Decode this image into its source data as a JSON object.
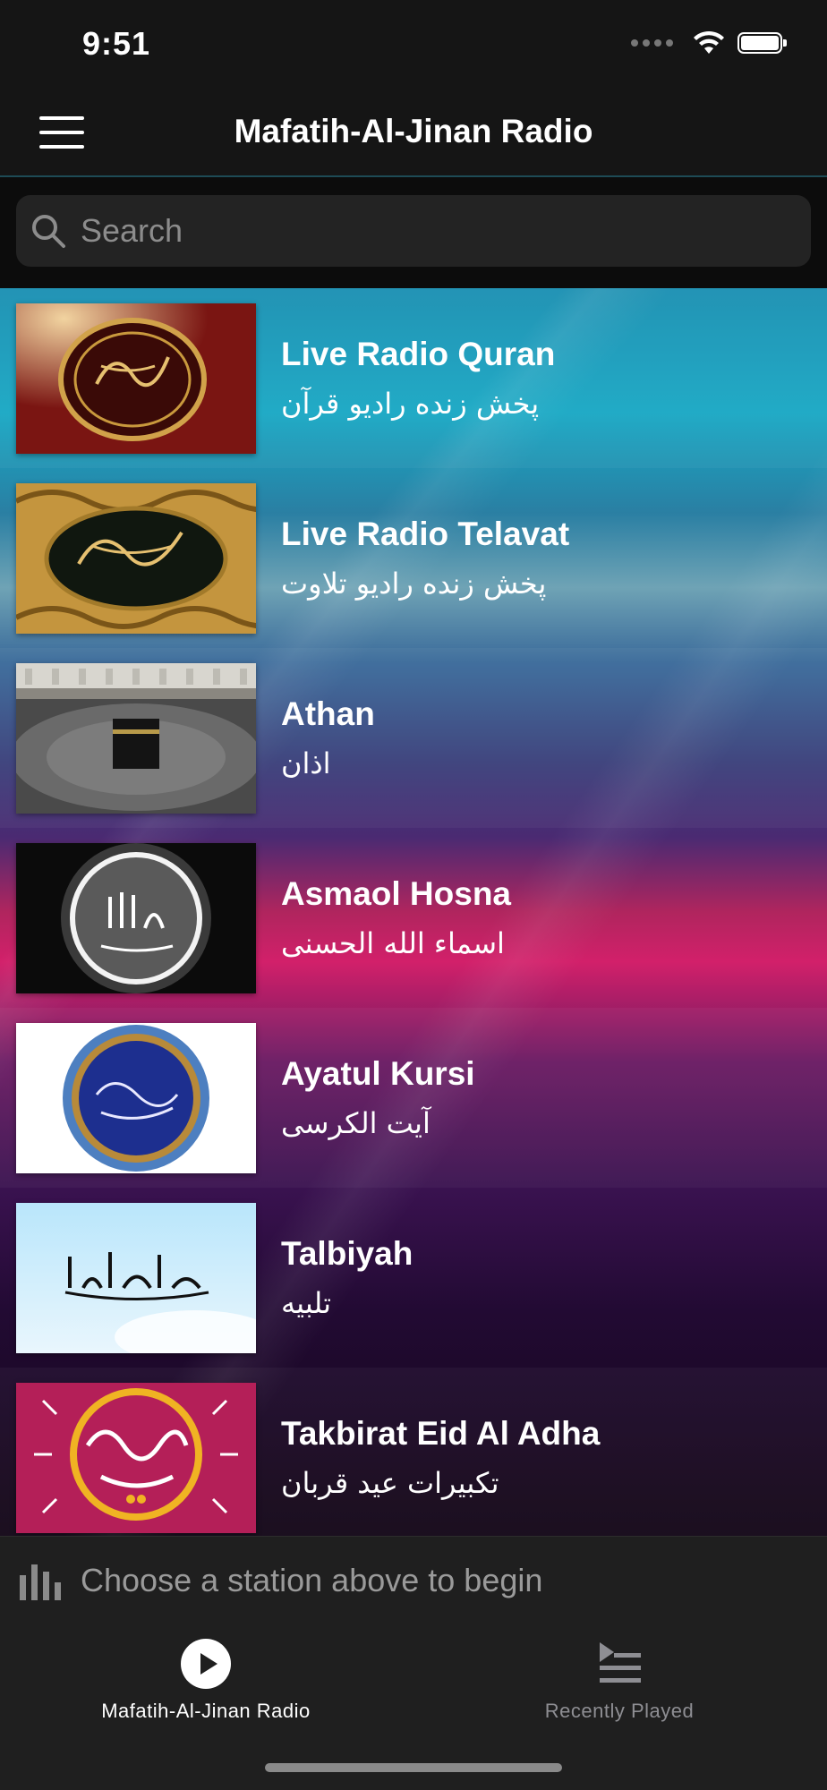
{
  "status_bar": {
    "time": "9:51"
  },
  "nav": {
    "title": "Mafatih-Al-Jinan Radio",
    "menu_icon": "hamburger-icon"
  },
  "search": {
    "placeholder": "Search",
    "value": ""
  },
  "stations": [
    {
      "title": "Live Radio Quran",
      "subtitle": "پخش زنده رادیو قرآن",
      "thumbnail": "quran-cover-red"
    },
    {
      "title": "Live Radio Telavat",
      "subtitle": "پخش زنده رادیو تلاوت",
      "thumbnail": "quran-cover-gold"
    },
    {
      "title": "Athan",
      "subtitle": "اذان",
      "thumbnail": "kaaba-photo"
    },
    {
      "title": "Asmaol Hosna",
      "subtitle": "اسماء الله الحسنی",
      "thumbnail": "allah-calligraphy-circle"
    },
    {
      "title": "Ayatul Kursi",
      "subtitle": "آیت الکرسی",
      "thumbnail": "blue-calligraphy-rosette"
    },
    {
      "title": "Talbiyah",
      "subtitle": "تلبیه",
      "thumbnail": "talbiyah-calligraphy-sky"
    },
    {
      "title": "Takbirat Eid Al Adha",
      "subtitle": "تکبیرات عید قربان",
      "thumbnail": "eid-mubarak-magenta"
    }
  ],
  "now_playing": {
    "text": "Choose a station above to begin"
  },
  "tabs": [
    {
      "label": "Mafatih-Al-Jinan Radio",
      "icon": "play-circle-icon",
      "active": true
    },
    {
      "label": "Recently Played",
      "icon": "queue-list-icon",
      "active": false
    }
  ],
  "colors": {
    "background": "#151515",
    "accent_line": "#1e4b56",
    "inactive_tab": "#8e8e93"
  }
}
